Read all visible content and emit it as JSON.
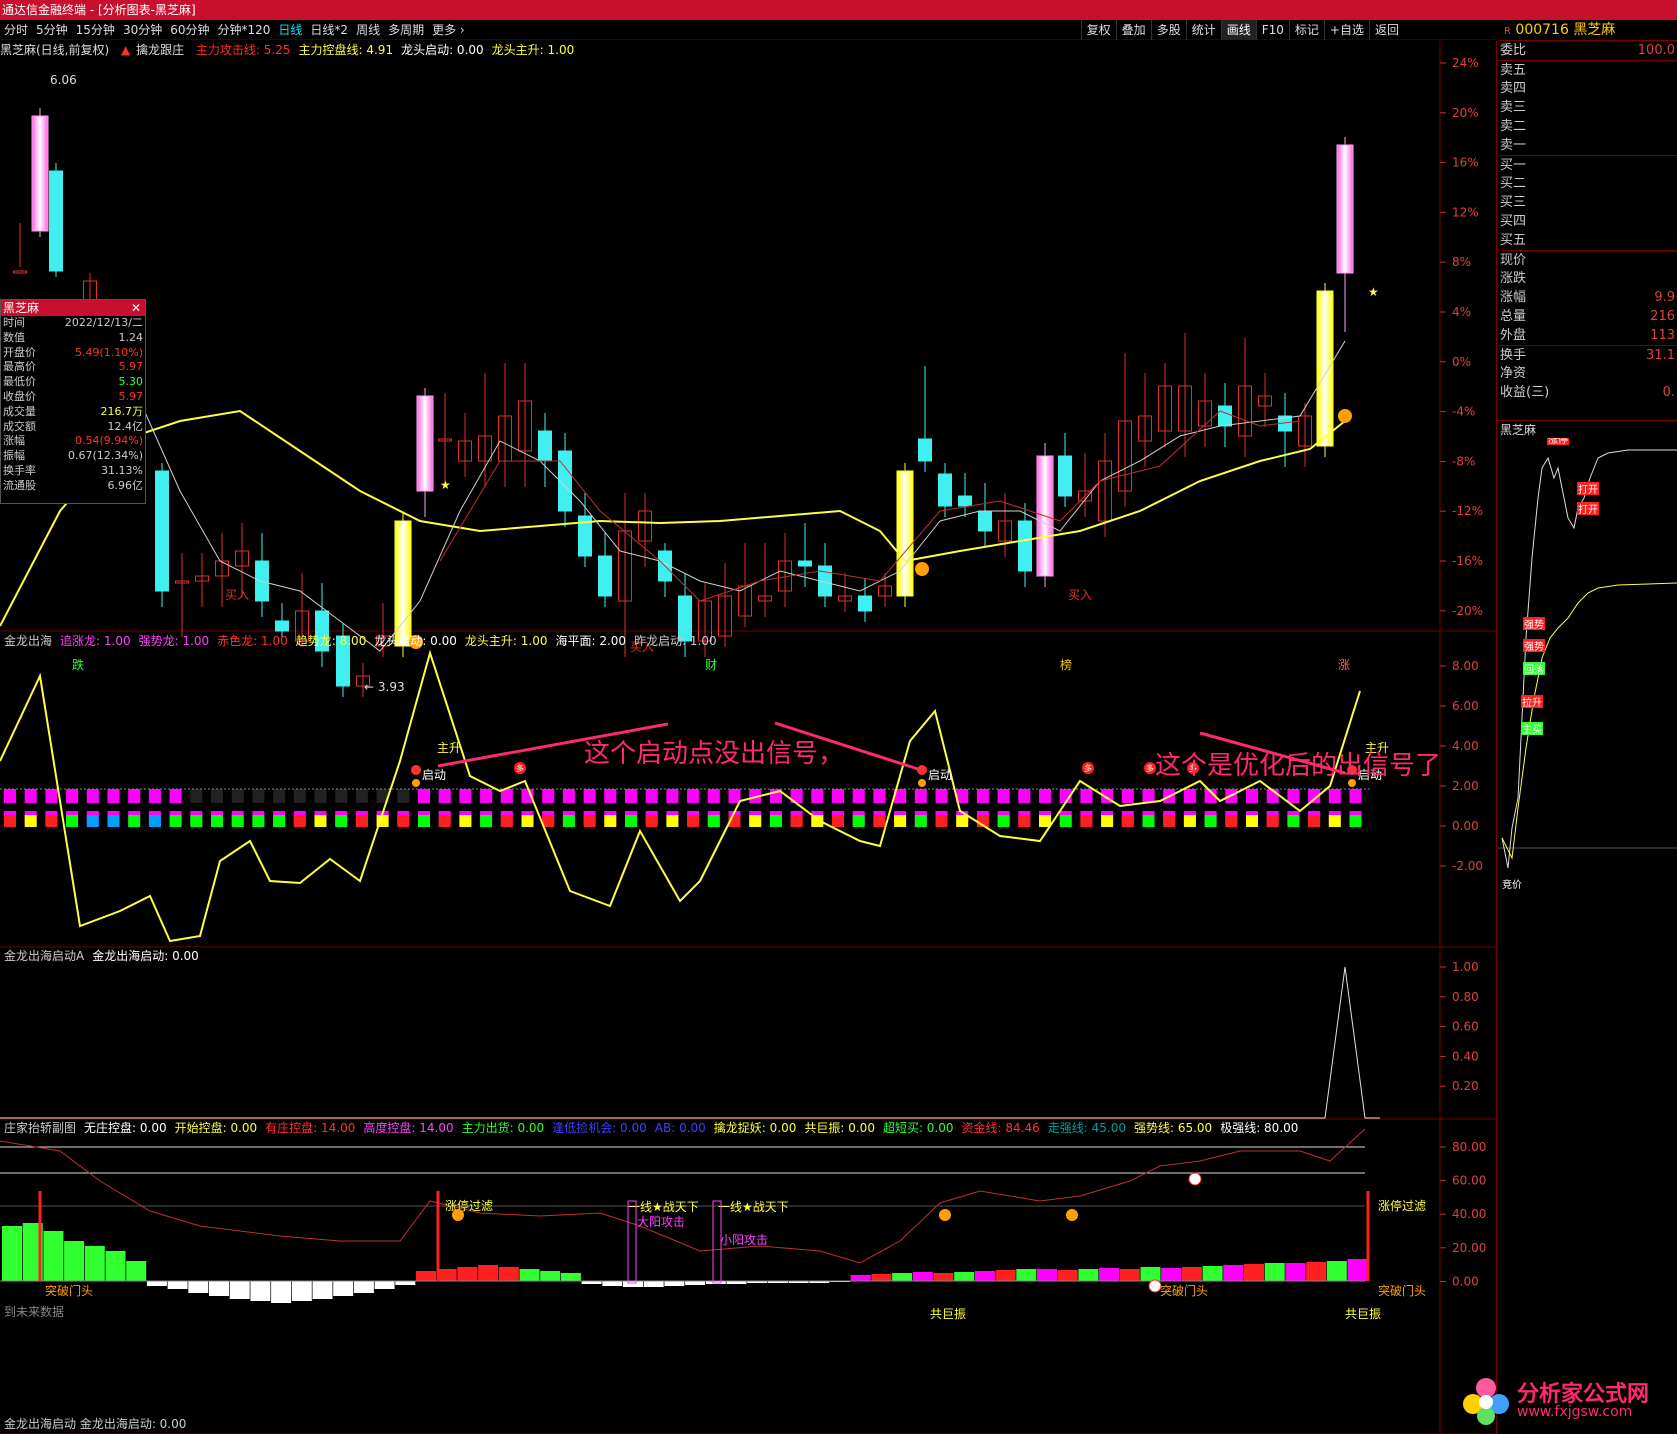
{
  "window": {
    "title": "通达信金融终端 - [分析图表-黑芝麻]"
  },
  "toolbar": {
    "periods": [
      "分时",
      "5分钟",
      "15分钟",
      "30分钟",
      "60分钟",
      "分钟*120",
      "日线",
      "日线*2",
      "周线",
      "多周期",
      "更多 ›"
    ],
    "active_period": "日线",
    "tools": [
      "复权",
      "叠加",
      "多股",
      "统计",
      "画线",
      "F10",
      "标记",
      "+自选",
      "返回"
    ]
  },
  "main_panel": {
    "header": {
      "stock": "黑芝麻(日线,前复权)",
      "indicator": "擒龙跟庄",
      "items": [
        {
          "label": "主力攻击线:",
          "value": "5.25",
          "color": "#ff3030"
        },
        {
          "label": "主力控盘线:",
          "value": "4.91",
          "color": "#ffff40"
        },
        {
          "label": "龙头启动:",
          "value": "0.00",
          "color": "#ffffff"
        },
        {
          "label": "龙头主升:",
          "value": "1.00",
          "color": "#ffff40"
        }
      ]
    },
    "y_ticks": [
      "24%",
      "20%",
      "16%",
      "12%",
      "8%",
      "4%",
      "0%",
      "-4%",
      "-8%",
      "-12%",
      "-16%",
      "-20%"
    ],
    "price_high_label": "6.06",
    "price_low_label": "3.93",
    "buy_label": "买入",
    "bottom_markers": [
      "跌",
      "财",
      "榜",
      "涨"
    ]
  },
  "infobox": {
    "title": "黑芝麻",
    "rows": [
      {
        "k": "时间",
        "v": "2022/12/13/二",
        "c": "#cccccc"
      },
      {
        "k": "数值",
        "v": "1.24",
        "c": "#cccccc"
      },
      {
        "k": "开盘价",
        "v": "5.49(1.10%)",
        "c": "#ff3030"
      },
      {
        "k": "最高价",
        "v": "5.97",
        "c": "#ff3030"
      },
      {
        "k": "最低价",
        "v": "5.30",
        "c": "#30ff30"
      },
      {
        "k": "收盘价",
        "v": "5.97",
        "c": "#ff3030"
      },
      {
        "k": "成交量",
        "v": "216.7万",
        "c": "#ffff40"
      },
      {
        "k": "成交额",
        "v": "12.4亿",
        "c": "#cccccc"
      },
      {
        "k": "涨幅",
        "v": "0.54(9.94%)",
        "c": "#ff3030"
      },
      {
        "k": "振幅",
        "v": "0.67(12.34%)",
        "c": "#cccccc"
      },
      {
        "k": "换手率",
        "v": "31.13%",
        "c": "#cccccc"
      },
      {
        "k": "流通股",
        "v": "6.96亿",
        "c": "#cccccc"
      }
    ]
  },
  "panel2": {
    "header": [
      {
        "label": "金龙出海",
        "value": "",
        "color": "#cccccc"
      },
      {
        "label": "追涨龙:",
        "value": "1.00",
        "color": "#ff40ff"
      },
      {
        "label": "强势龙:",
        "value": "1.00",
        "color": "#ff40ff"
      },
      {
        "label": "赤色龙:",
        "value": "1.00",
        "color": "#ff3030"
      },
      {
        "label": "趋势龙:",
        "value": "8.00",
        "color": "#ffff40"
      },
      {
        "label": "龙头启动:",
        "value": "0.00",
        "color": "#ffffff"
      },
      {
        "label": "龙头主升:",
        "value": "1.00",
        "color": "#ffff40"
      },
      {
        "label": "海平面:",
        "value": "2.00",
        "color": "#ffffff"
      },
      {
        "label": "昨龙启动:",
        "value": "1.00",
        "color": "#cccccc"
      }
    ],
    "y_ticks": [
      "8.00",
      "6.00",
      "4.00",
      "2.00",
      "0.00",
      "-2.00"
    ],
    "label_qidong": "启动",
    "label_zhusheng": "主升",
    "label_duo": "多"
  },
  "annotations": {
    "left": "这个启动点没出信号，",
    "right": "这个是优化后的出信号了"
  },
  "panel3": {
    "header": [
      {
        "label": "金龙出海启动A",
        "value": "",
        "color": "#cccccc"
      },
      {
        "label": "金龙出海启动:",
        "value": "0.00",
        "color": "#ffffff"
      }
    ],
    "y_ticks": [
      "1.00",
      "0.80",
      "0.60",
      "0.40",
      "0.20"
    ]
  },
  "panel4": {
    "header": [
      {
        "label": "庄家抬轿副图",
        "value": "",
        "color": "#cccccc"
      },
      {
        "label": "无庄控盘:",
        "value": "0.00",
        "color": "#ffffff"
      },
      {
        "label": "开始控盘:",
        "value": "0.00",
        "color": "#ffff40"
      },
      {
        "label": "有庄控盘:",
        "value": "14.00",
        "color": "#ff3030"
      },
      {
        "label": "高度控盘:",
        "value": "14.00",
        "color": "#ff40ff"
      },
      {
        "label": "主力出货:",
        "value": "0.00",
        "color": "#30ff30"
      },
      {
        "label": "逢低捡机会:",
        "value": "0.00",
        "color": "#4040ff"
      },
      {
        "label": "AB:",
        "value": "0.00",
        "color": "#4040ff"
      },
      {
        "label": "擒龙捉妖:",
        "value": "0.00",
        "color": "#ffff40"
      },
      {
        "label": "共巨振:",
        "value": "0.00",
        "color": "#ffff40"
      },
      {
        "label": "超短买:",
        "value": "0.00",
        "color": "#30ff30"
      },
      {
        "label": "资金线:",
        "value": "84.46",
        "color": "#ff3030"
      },
      {
        "label": "走强线:",
        "value": "45.00",
        "color": "#00a0a0"
      },
      {
        "label": "强势线:",
        "value": "65.00",
        "color": "#ffff40"
      },
      {
        "label": "极强线:",
        "value": "80.00",
        "color": "#ffffff"
      }
    ],
    "y_ticks": [
      "80.00",
      "60.00",
      "40.00",
      "20.00",
      "0.00"
    ],
    "labels": {
      "zt": "涨停过滤",
      "tp": "突破门头",
      "gjz": "共巨振",
      "ztx": "一线★战天下",
      "dyg": "大阳攻击",
      "xyg": "小阳攻击"
    }
  },
  "panel5": {
    "header": "金龙出海启动  金龙出海启动: 0.00",
    "nofuture": "到未来数据"
  },
  "sidebar": {
    "code": "000716",
    "name": "黑芝麻",
    "rows": [
      {
        "k": "委比",
        "v": "100.0"
      },
      {
        "k": "卖五",
        "v": ""
      },
      {
        "k": "卖四",
        "v": ""
      },
      {
        "k": "卖三",
        "v": ""
      },
      {
        "k": "卖二",
        "v": ""
      },
      {
        "k": "卖一",
        "v": ""
      },
      {
        "k": "买一",
        "v": ""
      },
      {
        "k": "买二",
        "v": ""
      },
      {
        "k": "买三",
        "v": ""
      },
      {
        "k": "买四",
        "v": ""
      },
      {
        "k": "买五",
        "v": ""
      },
      {
        "k": "现价",
        "v": ""
      },
      {
        "k": "涨跌",
        "v": ""
      },
      {
        "k": "涨幅",
        "v": "9.9"
      },
      {
        "k": "总量",
        "v": "216"
      },
      {
        "k": "外盘",
        "v": "113"
      },
      {
        "k": "换手",
        "v": "31.1"
      },
      {
        "k": "净资",
        "v": ""
      },
      {
        "k": "收益(三)",
        "v": "0."
      }
    ],
    "mini_title": "黑芝麻",
    "mini_labels": [
      "强势",
      "强势",
      "回落",
      "拉升",
      "主买",
      "竞价",
      "打开",
      "打开",
      "涨停"
    ]
  },
  "watermark": {
    "name": "分析家公式网",
    "url": "www.fxjgsw.com"
  }
}
